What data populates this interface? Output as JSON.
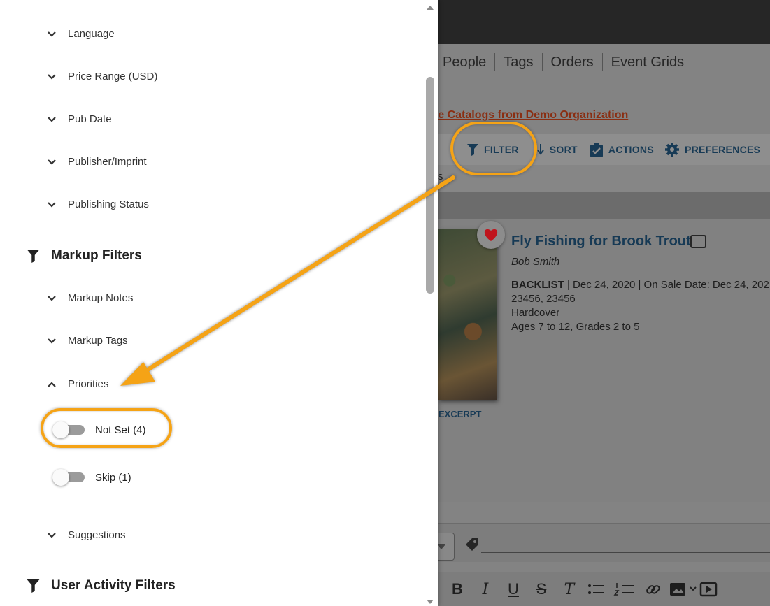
{
  "background_app": {
    "nav_tabs": [
      "People",
      "Tags",
      "Orders",
      "Event Grids"
    ],
    "catalog_link": "re Catalogs from Demo Organization",
    "toolbar": {
      "filter_label": "FILTER",
      "sort_label": "SORT",
      "actions_label": "ACTIONS",
      "preferences_label": "PREFERENCES"
    },
    "strip_fragment": "s",
    "book": {
      "title": "Fly Fishing for Brook Trout",
      "author": "Bob Smith",
      "status": "BACKLIST",
      "details_line": " | Dec 24, 2020 | On Sale Date: Dec 24, 202",
      "isbns": "23456, 23456",
      "format": "Hardcover",
      "ages": "Ages 7 to 12, Grades 2 to 5",
      "excerpt_label": "D EXCERPT"
    }
  },
  "drawer": {
    "filters_top": [
      {
        "label": "Language",
        "expanded": false
      },
      {
        "label": "Price Range (USD)",
        "expanded": false
      },
      {
        "label": "Pub Date",
        "expanded": false
      },
      {
        "label": "Publisher/Imprint",
        "expanded": false
      },
      {
        "label": "Publishing Status",
        "expanded": false
      }
    ],
    "markup_section": {
      "title": "Markup Filters",
      "filters": [
        {
          "label": "Markup Notes",
          "expanded": false
        },
        {
          "label": "Markup Tags",
          "expanded": false
        },
        {
          "label": "Priorities",
          "expanded": true
        },
        {
          "label": "Suggestions",
          "expanded": false
        }
      ],
      "priority_options": [
        {
          "label": "Not Set (4)",
          "on": false
        },
        {
          "label": "Skip (1)",
          "on": false
        }
      ]
    },
    "user_activity_section": {
      "title": "User Activity Filters"
    }
  },
  "colors": {
    "annotation": "#f5a316",
    "heading_link": "#173a55",
    "heart": "#c0141c"
  }
}
